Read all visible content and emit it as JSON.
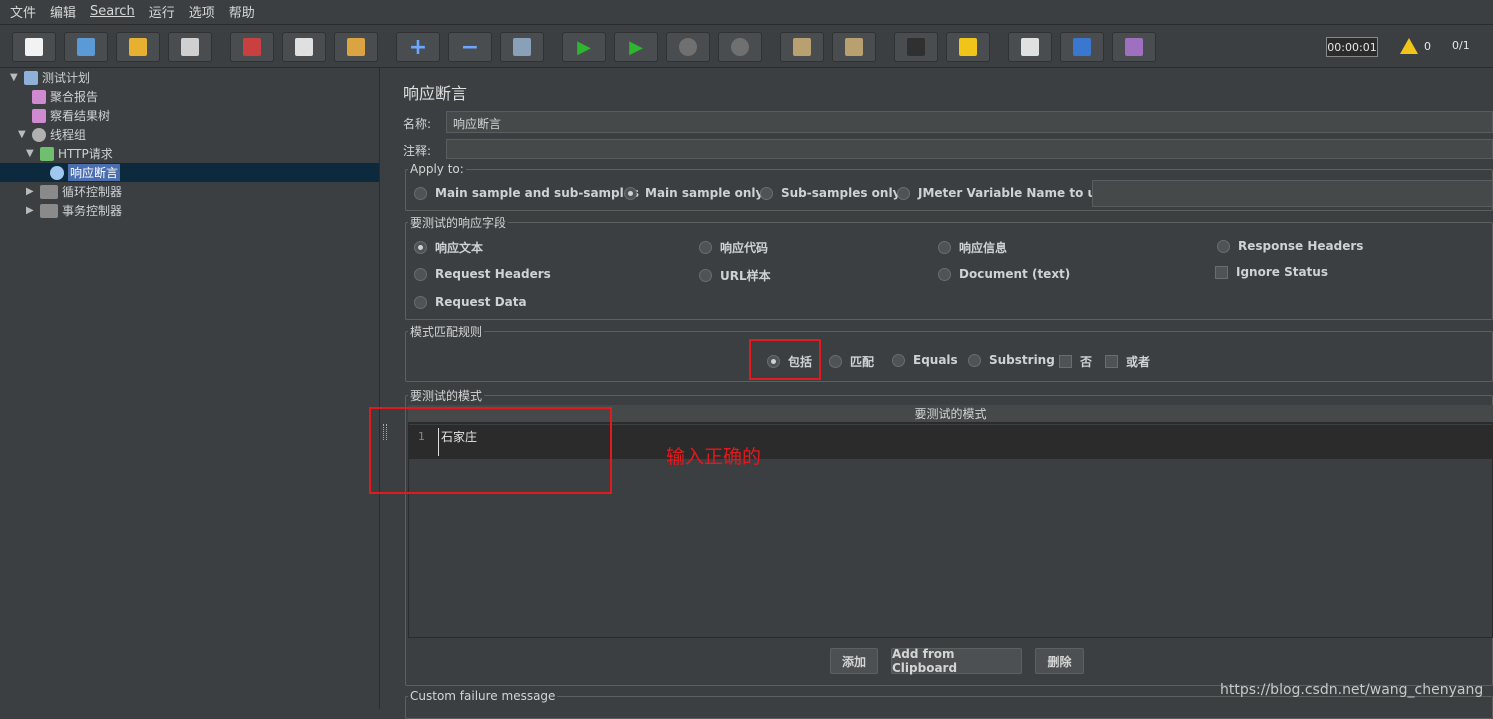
{
  "menu": [
    "文件",
    "编辑",
    "Search",
    "运行",
    "选项",
    "帮助"
  ],
  "toolbar": {
    "timer": "00:00:01",
    "warnings": "0",
    "threads": "0/1"
  },
  "tree": [
    {
      "label": "测试计划",
      "icon": "test-plan-icon"
    },
    {
      "label": "聚合报告",
      "icon": "report-icon"
    },
    {
      "label": "察看结果树",
      "icon": "report-icon"
    },
    {
      "label": "线程组",
      "icon": "gear-icon"
    },
    {
      "label": "HTTP请求",
      "icon": "pipette-icon"
    },
    {
      "label": "响应断言",
      "icon": "magnifier-icon"
    },
    {
      "label": "循环控制器",
      "icon": "controller-icon"
    },
    {
      "label": "事务控制器",
      "icon": "controller-icon"
    }
  ],
  "panel": {
    "title": "响应断言",
    "name_label": "名称:",
    "name_value": "响应断言",
    "comment_label": "注释:",
    "apply_to": {
      "legend": "Apply to:",
      "options": [
        "Main sample and sub-samples",
        "Main sample only",
        "Sub-samples only",
        "JMeter Variable Name to use"
      ],
      "selected": 1
    },
    "fields": {
      "legend": "要测试的响应字段",
      "options": [
        "响应文本",
        "响应代码",
        "响应信息",
        "Response Headers",
        "Request Headers",
        "URL样本",
        "Document (text)",
        "Ignore Status",
        "Request Data"
      ],
      "selected": 0
    },
    "rules": {
      "legend": "模式匹配规则",
      "options": [
        "包括",
        "匹配",
        "Equals",
        "Substring",
        "否",
        "或者"
      ],
      "selected": 0
    },
    "patterns": {
      "legend": "要测试的模式",
      "column": "要测试的模式",
      "line_no": "1",
      "value": "石家庄"
    },
    "buttons": {
      "add": "添加",
      "clipboard": "Add from Clipboard",
      "delete": "删除"
    },
    "failure_legend": "Custom failure message"
  },
  "annotation": "输入正确的",
  "watermark": "https://blog.csdn.net/wang_chenyang",
  "colors": {
    "highlight": "#e3191d",
    "selection": "#4b6eaf"
  }
}
